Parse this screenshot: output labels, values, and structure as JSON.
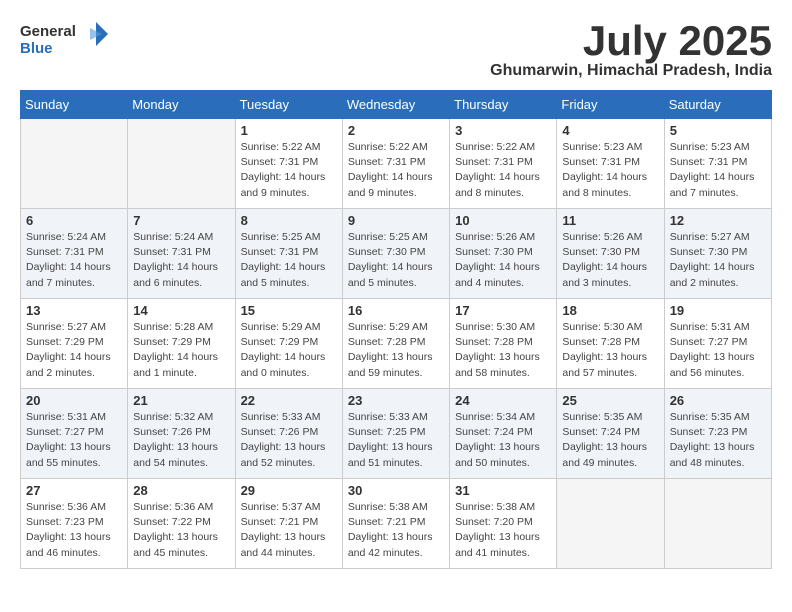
{
  "logo": {
    "general": "General",
    "blue": "Blue"
  },
  "title": {
    "month": "July 2025",
    "location": "Ghumarwin, Himachal Pradesh, India"
  },
  "weekdays": [
    "Sunday",
    "Monday",
    "Tuesday",
    "Wednesday",
    "Thursday",
    "Friday",
    "Saturday"
  ],
  "weeks": [
    [
      {
        "day": "",
        "empty": true
      },
      {
        "day": "",
        "empty": true
      },
      {
        "day": "1",
        "sunrise": "Sunrise: 5:22 AM",
        "sunset": "Sunset: 7:31 PM",
        "daylight": "Daylight: 14 hours and 9 minutes."
      },
      {
        "day": "2",
        "sunrise": "Sunrise: 5:22 AM",
        "sunset": "Sunset: 7:31 PM",
        "daylight": "Daylight: 14 hours and 9 minutes."
      },
      {
        "day": "3",
        "sunrise": "Sunrise: 5:22 AM",
        "sunset": "Sunset: 7:31 PM",
        "daylight": "Daylight: 14 hours and 8 minutes."
      },
      {
        "day": "4",
        "sunrise": "Sunrise: 5:23 AM",
        "sunset": "Sunset: 7:31 PM",
        "daylight": "Daylight: 14 hours and 8 minutes."
      },
      {
        "day": "5",
        "sunrise": "Sunrise: 5:23 AM",
        "sunset": "Sunset: 7:31 PM",
        "daylight": "Daylight: 14 hours and 7 minutes."
      }
    ],
    [
      {
        "day": "6",
        "sunrise": "Sunrise: 5:24 AM",
        "sunset": "Sunset: 7:31 PM",
        "daylight": "Daylight: 14 hours and 7 minutes."
      },
      {
        "day": "7",
        "sunrise": "Sunrise: 5:24 AM",
        "sunset": "Sunset: 7:31 PM",
        "daylight": "Daylight: 14 hours and 6 minutes."
      },
      {
        "day": "8",
        "sunrise": "Sunrise: 5:25 AM",
        "sunset": "Sunset: 7:31 PM",
        "daylight": "Daylight: 14 hours and 5 minutes."
      },
      {
        "day": "9",
        "sunrise": "Sunrise: 5:25 AM",
        "sunset": "Sunset: 7:30 PM",
        "daylight": "Daylight: 14 hours and 5 minutes."
      },
      {
        "day": "10",
        "sunrise": "Sunrise: 5:26 AM",
        "sunset": "Sunset: 7:30 PM",
        "daylight": "Daylight: 14 hours and 4 minutes."
      },
      {
        "day": "11",
        "sunrise": "Sunrise: 5:26 AM",
        "sunset": "Sunset: 7:30 PM",
        "daylight": "Daylight: 14 hours and 3 minutes."
      },
      {
        "day": "12",
        "sunrise": "Sunrise: 5:27 AM",
        "sunset": "Sunset: 7:30 PM",
        "daylight": "Daylight: 14 hours and 2 minutes."
      }
    ],
    [
      {
        "day": "13",
        "sunrise": "Sunrise: 5:27 AM",
        "sunset": "Sunset: 7:29 PM",
        "daylight": "Daylight: 14 hours and 2 minutes."
      },
      {
        "day": "14",
        "sunrise": "Sunrise: 5:28 AM",
        "sunset": "Sunset: 7:29 PM",
        "daylight": "Daylight: 14 hours and 1 minute."
      },
      {
        "day": "15",
        "sunrise": "Sunrise: 5:29 AM",
        "sunset": "Sunset: 7:29 PM",
        "daylight": "Daylight: 14 hours and 0 minutes."
      },
      {
        "day": "16",
        "sunrise": "Sunrise: 5:29 AM",
        "sunset": "Sunset: 7:28 PM",
        "daylight": "Daylight: 13 hours and 59 minutes."
      },
      {
        "day": "17",
        "sunrise": "Sunrise: 5:30 AM",
        "sunset": "Sunset: 7:28 PM",
        "daylight": "Daylight: 13 hours and 58 minutes."
      },
      {
        "day": "18",
        "sunrise": "Sunrise: 5:30 AM",
        "sunset": "Sunset: 7:28 PM",
        "daylight": "Daylight: 13 hours and 57 minutes."
      },
      {
        "day": "19",
        "sunrise": "Sunrise: 5:31 AM",
        "sunset": "Sunset: 7:27 PM",
        "daylight": "Daylight: 13 hours and 56 minutes."
      }
    ],
    [
      {
        "day": "20",
        "sunrise": "Sunrise: 5:31 AM",
        "sunset": "Sunset: 7:27 PM",
        "daylight": "Daylight: 13 hours and 55 minutes."
      },
      {
        "day": "21",
        "sunrise": "Sunrise: 5:32 AM",
        "sunset": "Sunset: 7:26 PM",
        "daylight": "Daylight: 13 hours and 54 minutes."
      },
      {
        "day": "22",
        "sunrise": "Sunrise: 5:33 AM",
        "sunset": "Sunset: 7:26 PM",
        "daylight": "Daylight: 13 hours and 52 minutes."
      },
      {
        "day": "23",
        "sunrise": "Sunrise: 5:33 AM",
        "sunset": "Sunset: 7:25 PM",
        "daylight": "Daylight: 13 hours and 51 minutes."
      },
      {
        "day": "24",
        "sunrise": "Sunrise: 5:34 AM",
        "sunset": "Sunset: 7:24 PM",
        "daylight": "Daylight: 13 hours and 50 minutes."
      },
      {
        "day": "25",
        "sunrise": "Sunrise: 5:35 AM",
        "sunset": "Sunset: 7:24 PM",
        "daylight": "Daylight: 13 hours and 49 minutes."
      },
      {
        "day": "26",
        "sunrise": "Sunrise: 5:35 AM",
        "sunset": "Sunset: 7:23 PM",
        "daylight": "Daylight: 13 hours and 48 minutes."
      }
    ],
    [
      {
        "day": "27",
        "sunrise": "Sunrise: 5:36 AM",
        "sunset": "Sunset: 7:23 PM",
        "daylight": "Daylight: 13 hours and 46 minutes."
      },
      {
        "day": "28",
        "sunrise": "Sunrise: 5:36 AM",
        "sunset": "Sunset: 7:22 PM",
        "daylight": "Daylight: 13 hours and 45 minutes."
      },
      {
        "day": "29",
        "sunrise": "Sunrise: 5:37 AM",
        "sunset": "Sunset: 7:21 PM",
        "daylight": "Daylight: 13 hours and 44 minutes."
      },
      {
        "day": "30",
        "sunrise": "Sunrise: 5:38 AM",
        "sunset": "Sunset: 7:21 PM",
        "daylight": "Daylight: 13 hours and 42 minutes."
      },
      {
        "day": "31",
        "sunrise": "Sunrise: 5:38 AM",
        "sunset": "Sunset: 7:20 PM",
        "daylight": "Daylight: 13 hours and 41 minutes."
      },
      {
        "day": "",
        "empty": true
      },
      {
        "day": "",
        "empty": true
      }
    ]
  ]
}
